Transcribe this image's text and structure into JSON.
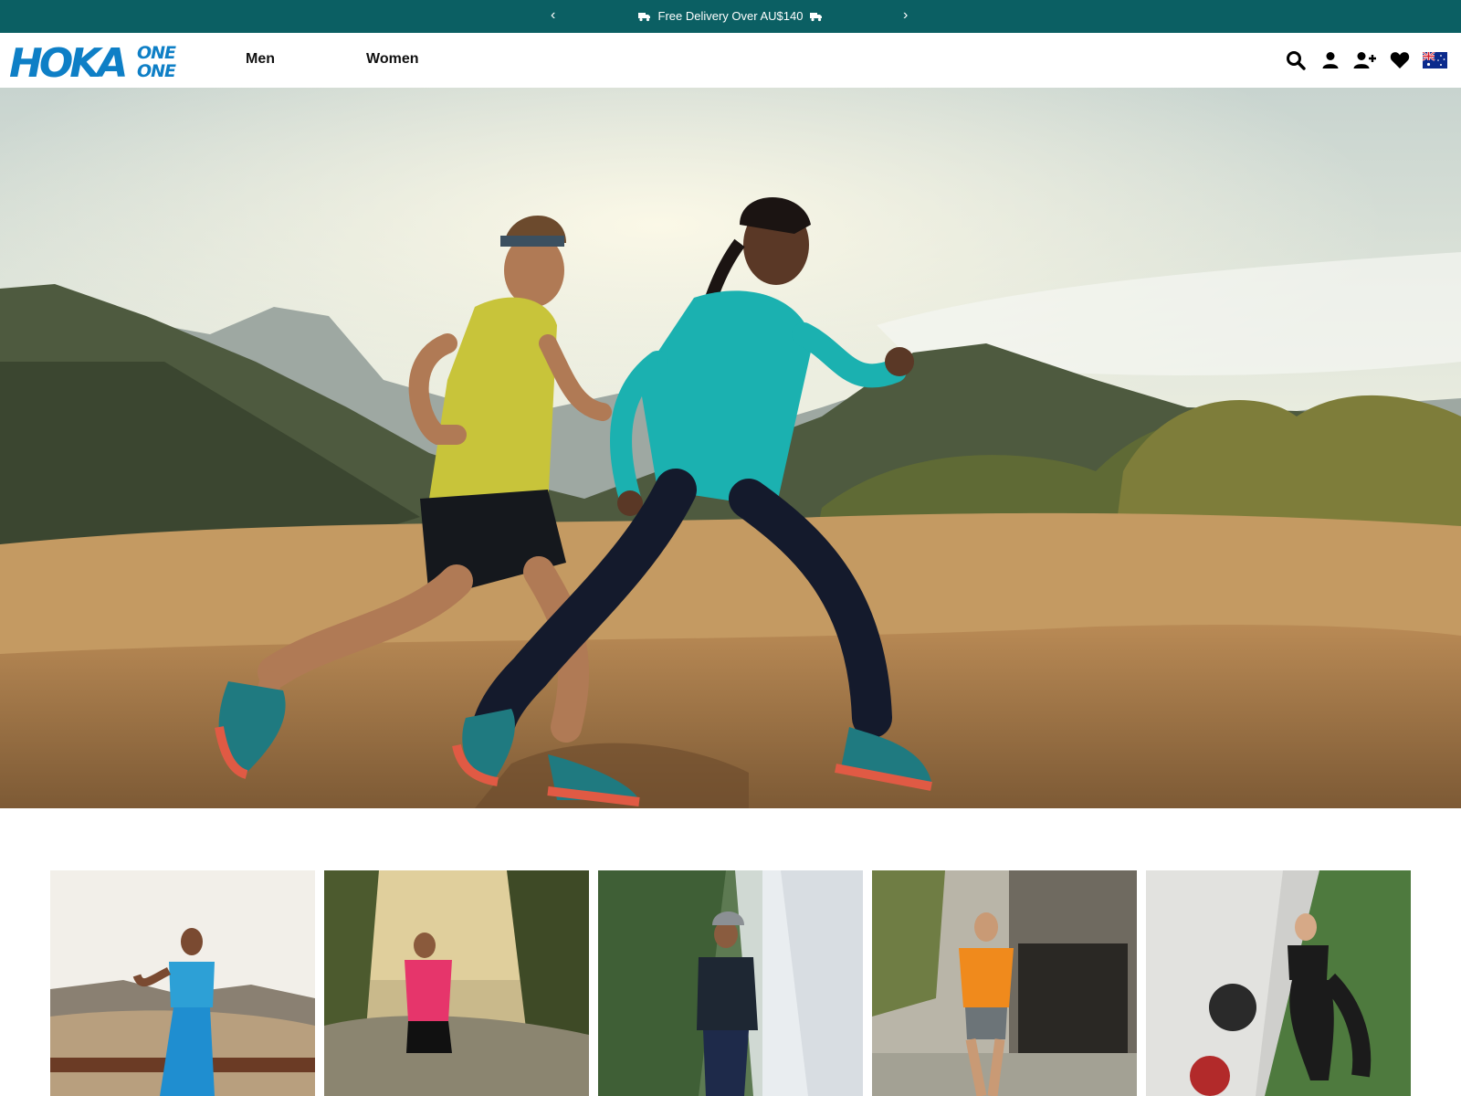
{
  "promo": {
    "prev_icon": "chevron-left-icon",
    "message": "Free Delivery Over AU$140",
    "next_icon": "chevron-right-icon",
    "left_arrow": "‹",
    "right_arrow": "›",
    "background": "#0b5f63"
  },
  "header": {
    "brand_logo": {
      "word": "HOKA",
      "tag_line_1": "ONE",
      "tag_line_2": "ONE",
      "color": "#0e7fc6"
    },
    "nav": [
      {
        "label": "Men"
      },
      {
        "label": "Women"
      }
    ],
    "icons": [
      "search-icon",
      "account-icon",
      "add-user-icon",
      "wishlist-heart-icon",
      "australia-flag-icon"
    ]
  },
  "hero": {
    "image": "trail-runners-hero"
  },
  "tiles": [
    {
      "image": "runner-blue-sports-bra"
    },
    {
      "image": "runner-pink-tee-forest"
    },
    {
      "image": "hiker-waterfall-jacket"
    },
    {
      "image": "man-orange-tee-street"
    },
    {
      "image": "woman-kettlebell-workout"
    }
  ]
}
